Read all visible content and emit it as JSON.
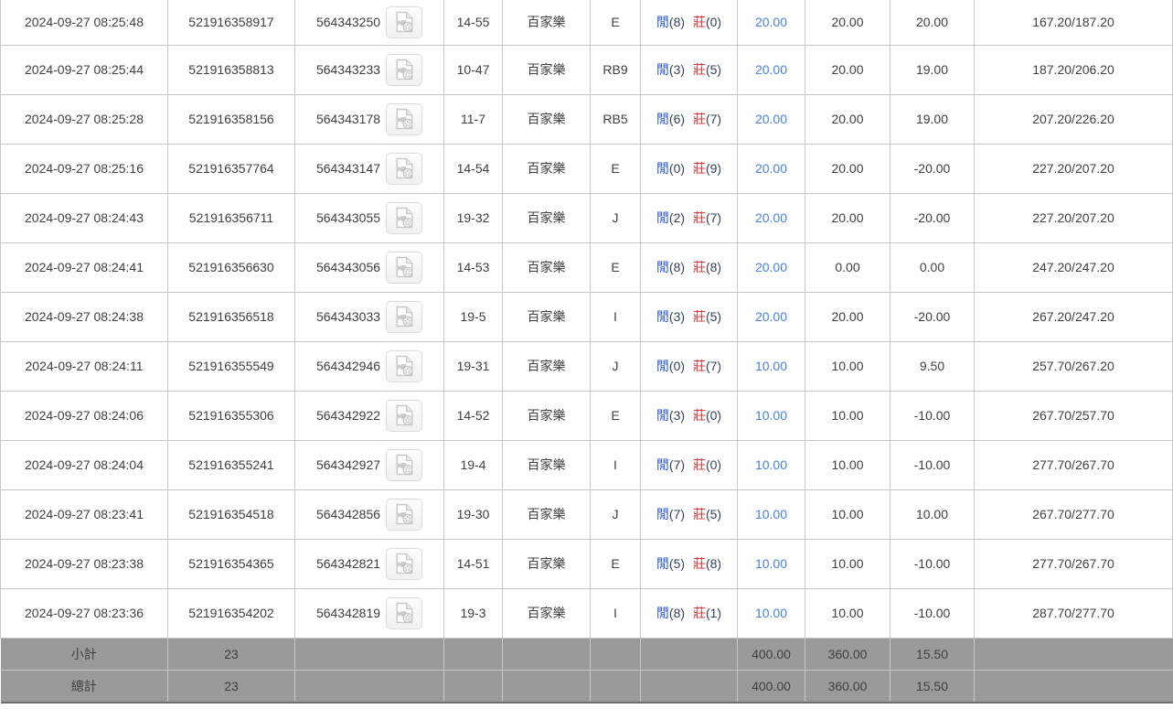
{
  "labels": {
    "player": "閒",
    "banker": "莊"
  },
  "icons": {
    "video": "video-file-icon"
  },
  "colors": {
    "bet_blue": "#4380f5",
    "player_blue": "#2956e0",
    "banker_red": "#e63333",
    "loss_red": "#ee2222",
    "footer_bg": "#9a9a9a"
  },
  "rows": [
    {
      "time": "2024-09-27 08:25:48",
      "bet_id": "521916358917",
      "round_id": "564343250",
      "table_no": "14-55",
      "game": "百家樂",
      "bet_type": "E",
      "player_pts": "8",
      "banker_pts": "0",
      "bet": "20.00",
      "valid_bet": "20.00",
      "win_loss": "20.00",
      "balance": "167.20/187.20"
    },
    {
      "time": "2024-09-27 08:25:44",
      "bet_id": "521916358813",
      "round_id": "564343233",
      "table_no": "10-47",
      "game": "百家樂",
      "bet_type": "RB9",
      "player_pts": "3",
      "banker_pts": "5",
      "bet": "20.00",
      "valid_bet": "20.00",
      "win_loss": "19.00",
      "balance": "187.20/206.20"
    },
    {
      "time": "2024-09-27 08:25:28",
      "bet_id": "521916358156",
      "round_id": "564343178",
      "table_no": "11-7",
      "game": "百家樂",
      "bet_type": "RB5",
      "player_pts": "6",
      "banker_pts": "7",
      "bet": "20.00",
      "valid_bet": "20.00",
      "win_loss": "19.00",
      "balance": "207.20/226.20"
    },
    {
      "time": "2024-09-27 08:25:16",
      "bet_id": "521916357764",
      "round_id": "564343147",
      "table_no": "14-54",
      "game": "百家樂",
      "bet_type": "E",
      "player_pts": "0",
      "banker_pts": "9",
      "bet": "20.00",
      "valid_bet": "20.00",
      "win_loss": "-20.00",
      "balance": "227.20/207.20"
    },
    {
      "time": "2024-09-27 08:24:43",
      "bet_id": "521916356711",
      "round_id": "564343055",
      "table_no": "19-32",
      "game": "百家樂",
      "bet_type": "J",
      "player_pts": "2",
      "banker_pts": "7",
      "bet": "20.00",
      "valid_bet": "20.00",
      "win_loss": "-20.00",
      "balance": "227.20/207.20"
    },
    {
      "time": "2024-09-27 08:24:41",
      "bet_id": "521916356630",
      "round_id": "564343056",
      "table_no": "14-53",
      "game": "百家樂",
      "bet_type": "E",
      "player_pts": "8",
      "banker_pts": "8",
      "bet": "20.00",
      "valid_bet": "0.00",
      "win_loss": "0.00",
      "balance": "247.20/247.20"
    },
    {
      "time": "2024-09-27 08:24:38",
      "bet_id": "521916356518",
      "round_id": "564343033",
      "table_no": "19-5",
      "game": "百家樂",
      "bet_type": "I",
      "player_pts": "3",
      "banker_pts": "5",
      "bet": "20.00",
      "valid_bet": "20.00",
      "win_loss": "-20.00",
      "balance": "267.20/247.20"
    },
    {
      "time": "2024-09-27 08:24:11",
      "bet_id": "521916355549",
      "round_id": "564342946",
      "table_no": "19-31",
      "game": "百家樂",
      "bet_type": "J",
      "player_pts": "0",
      "banker_pts": "7",
      "bet": "10.00",
      "valid_bet": "10.00",
      "win_loss": "9.50",
      "balance": "257.70/267.20"
    },
    {
      "time": "2024-09-27 08:24:06",
      "bet_id": "521916355306",
      "round_id": "564342922",
      "table_no": "14-52",
      "game": "百家樂",
      "bet_type": "E",
      "player_pts": "3",
      "banker_pts": "0",
      "bet": "10.00",
      "valid_bet": "10.00",
      "win_loss": "-10.00",
      "balance": "267.70/257.70"
    },
    {
      "time": "2024-09-27 08:24:04",
      "bet_id": "521916355241",
      "round_id": "564342927",
      "table_no": "19-4",
      "game": "百家樂",
      "bet_type": "I",
      "player_pts": "7",
      "banker_pts": "0",
      "bet": "10.00",
      "valid_bet": "10.00",
      "win_loss": "-10.00",
      "balance": "277.70/267.70"
    },
    {
      "time": "2024-09-27 08:23:41",
      "bet_id": "521916354518",
      "round_id": "564342856",
      "table_no": "19-30",
      "game": "百家樂",
      "bet_type": "J",
      "player_pts": "7",
      "banker_pts": "5",
      "bet": "10.00",
      "valid_bet": "10.00",
      "win_loss": "10.00",
      "balance": "267.70/277.70"
    },
    {
      "time": "2024-09-27 08:23:38",
      "bet_id": "521916354365",
      "round_id": "564342821",
      "table_no": "14-51",
      "game": "百家樂",
      "bet_type": "E",
      "player_pts": "5",
      "banker_pts": "8",
      "bet": "10.00",
      "valid_bet": "10.00",
      "win_loss": "-10.00",
      "balance": "277.70/267.70"
    },
    {
      "time": "2024-09-27 08:23:36",
      "bet_id": "521916354202",
      "round_id": "564342819",
      "table_no": "19-3",
      "game": "百家樂",
      "bet_type": "I",
      "player_pts": "8",
      "banker_pts": "1",
      "bet": "10.00",
      "valid_bet": "10.00",
      "win_loss": "-10.00",
      "balance": "287.70/277.70"
    }
  ],
  "footer_rows": [
    {
      "name": "subtotal",
      "label": "小計",
      "count": "23",
      "bet_total": "400.00",
      "valid_total": "360.00",
      "winloss_total": "15.50"
    },
    {
      "name": "total",
      "label": "總計",
      "count": "23",
      "bet_total": "400.00",
      "valid_total": "360.00",
      "winloss_total": "15.50"
    }
  ]
}
